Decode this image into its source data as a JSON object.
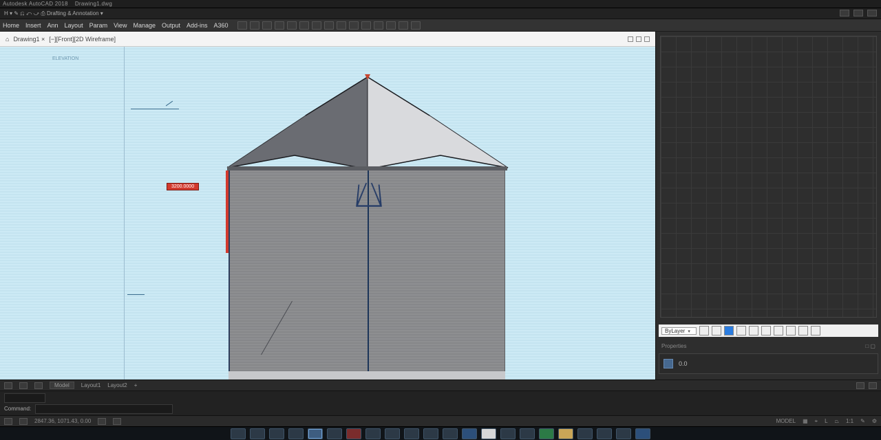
{
  "title_strip": {
    "left": "Autodesk  AutoCAD 2018",
    "right": "Drawing1.dwg"
  },
  "quick_access": {
    "text": "H  ▾  ✎  ⎌  ⤺  ⤻  ⎙   Drafting & Annotation  ▾"
  },
  "menu": {
    "items": [
      "Home",
      "Insert",
      "Ann",
      "Layout",
      "Param",
      "View",
      "Manage",
      "Output",
      "Add-ins",
      "A360"
    ],
    "icon_count": 15
  },
  "doc_tab": {
    "home_icon": "⌂",
    "name": "Drawing1  ×",
    "view_label": "[−][Front][2D Wireframe]"
  },
  "canvas": {
    "top_note": "ELEVATION",
    "dim_badge": "3200.0000"
  },
  "side": {
    "selector_label": "ByLayer",
    "hint_left": "Properties",
    "hint_right": "□ ▢",
    "coord": "0.0"
  },
  "layout_tabs": {
    "items": [
      "Model",
      "Layout1",
      "Layout2",
      "+"
    ]
  },
  "status": {
    "coords": "2847.36, 1071.43, 0.00",
    "right": [
      "MODEL",
      "▦",
      "⌖",
      "L",
      "⏢",
      "1:1",
      "✎",
      "⚙"
    ]
  },
  "command": {
    "prompt": "Command:",
    "value": ""
  },
  "taskbar": {
    "count": 22,
    "active_index": 4
  }
}
